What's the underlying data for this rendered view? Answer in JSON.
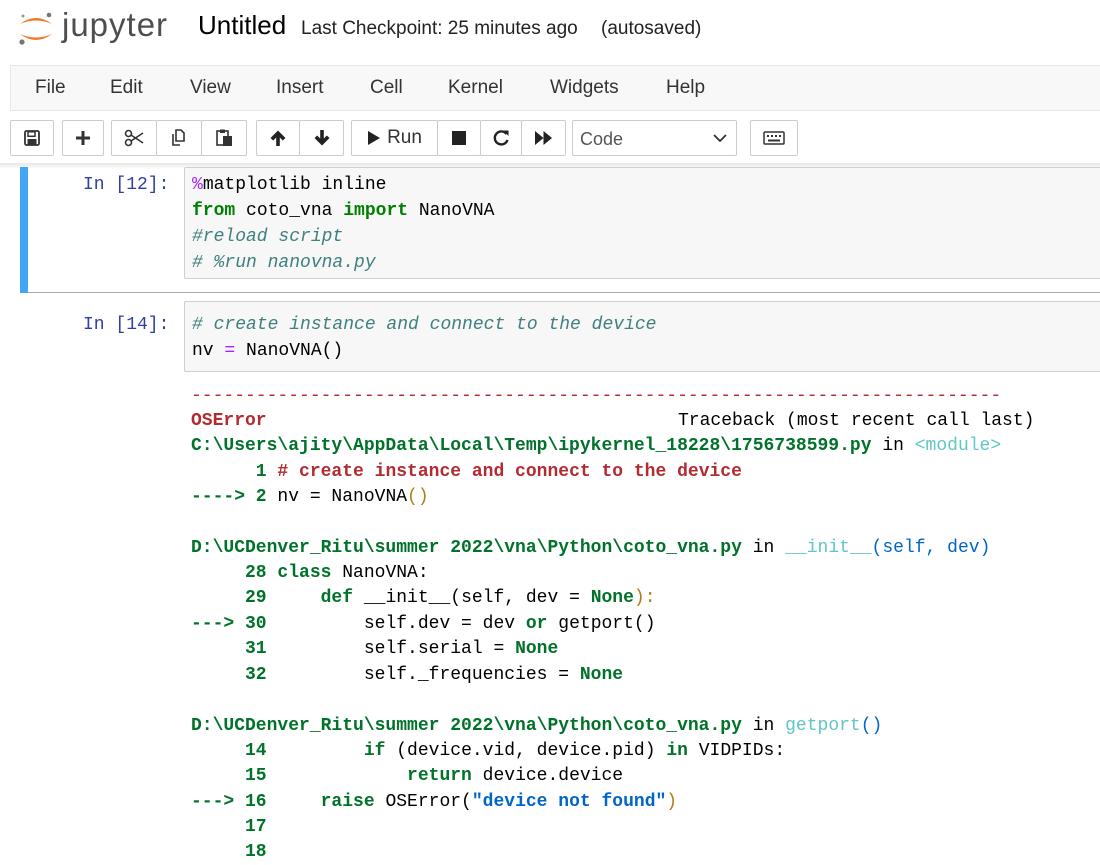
{
  "header": {
    "logo_text": "jupyter",
    "notebook_name": "Untitled",
    "checkpoint": "Last Checkpoint: 25 minutes ago",
    "autosave": "(autosaved)"
  },
  "menu": [
    "File",
    "Edit",
    "View",
    "Insert",
    "Cell",
    "Kernel",
    "Widgets",
    "Help"
  ],
  "toolbar": {
    "run_label": "Run",
    "cell_type": "Code",
    "icons": [
      "save-icon",
      "plus-icon",
      "scissors-icon",
      "copy-icon",
      "paste-icon",
      "arrow-up-icon",
      "arrow-down-icon",
      "run-icon",
      "stop-icon",
      "restart-icon",
      "fast-forward-icon",
      "keyboard-icon"
    ]
  },
  "cells": [
    {
      "prompt": "In [12]:",
      "lines": {
        "l1_magic": "%",
        "l1_rest": "matplotlib inline",
        "l2_from": "from",
        "l2_mod": " coto_vna ",
        "l2_import": "import",
        "l2_name": " NanoVNA",
        "l3": "#reload script",
        "l4": "# %run nanovna.py"
      }
    },
    {
      "prompt": "In [14]:",
      "lines": {
        "l1": "# create instance and connect to the device",
        "l2_a": "nv ",
        "l2_eq": "=",
        "l2_b": " NanoVNA()"
      }
    }
  ],
  "traceback": {
    "dashes": "---------------------------------------------------------------------------",
    "error_name": "OSError",
    "traceback_header": "Traceback (most recent call last)",
    "frame1_path": "C:\\Users\\ajity\\AppData\\Local\\Temp\\ipykernel_18228\\1756738599.py",
    "frame1_in": " in ",
    "frame1_func": "<module>",
    "frame1_l1_num": "      1 ",
    "frame1_l1_code": "# create instance and connect to the device",
    "frame1_l2_arrow": "----> 2 ",
    "frame1_l2_a": "nv = NanoVNA",
    "frame1_l2_paren": "()",
    "frame2_path": "D:\\UCDenver_Ritu\\summer 2022\\vna\\Python\\coto_vna.py",
    "frame2_in": " in ",
    "frame2_func": "__init__",
    "frame2_args_open": "(",
    "frame2_args": "self, dev",
    "frame2_args_close": ")",
    "f2_l28_num": "     28 ",
    "f2_l28_kw": "class",
    "f2_l28_rest": " NanoVNA:",
    "f2_l29_num": "     29 ",
    "f2_l29_kw": "    def",
    "f2_l29_rest": " __init__(self, dev = ",
    "f2_l29_none": "None",
    "f2_l29_end": "):",
    "f2_l30_arrow": "---> 30 ",
    "f2_l30_a": "        self.dev = dev ",
    "f2_l30_or": "or",
    "f2_l30_b": " getport()",
    "f2_l31_num": "     31 ",
    "f2_l31_a": "        self.serial = ",
    "f2_l31_none": "None",
    "f2_l32_num": "     32 ",
    "f2_l32_a": "        self._frequencies = ",
    "f2_l32_none": "None",
    "frame3_path": "D:\\UCDenver_Ritu\\summer 2022\\vna\\Python\\coto_vna.py",
    "frame3_in": " in ",
    "frame3_func": "getport",
    "frame3_paren": "()",
    "f3_l14_num": "     14 ",
    "f3_l14_kw": "        if",
    "f3_l14_rest": " (device.vid, device.pid) ",
    "f3_l14_in": "in",
    "f3_l14_end": " VIDPIDs:",
    "f3_l15_num": "     15 ",
    "f3_l15_kw": "            return",
    "f3_l15_rest": " device.device",
    "f3_l16_arrow": "---> 16 ",
    "f3_l16_kw": "    raise",
    "f3_l16_a": " OSError(",
    "f3_l16_str": "\"device not found\"",
    "f3_l16_end": ")",
    "f3_l17_num": "     17",
    "f3_l18_num": "     18"
  }
}
